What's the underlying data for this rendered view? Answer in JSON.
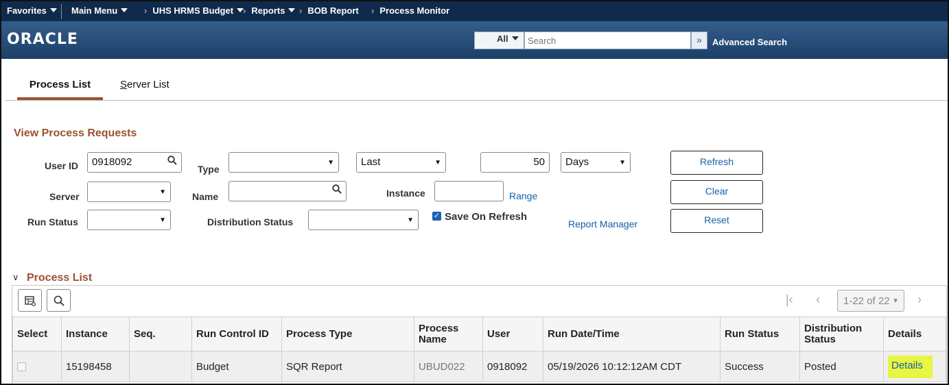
{
  "nav": {
    "favorites": "Favorites",
    "main_menu": "Main Menu",
    "crumbs": [
      "UHS HRMS Budget",
      "Reports",
      "BOB Report",
      "Process Monitor"
    ]
  },
  "banner": {
    "logo": "ORACLE",
    "search_scope": "All",
    "search_placeholder": "Search",
    "advanced_search": "Advanced Search"
  },
  "tabs": {
    "active": "Process List",
    "inactive_first": "S",
    "inactive_rest": "erver List"
  },
  "form": {
    "title": "View Process Requests",
    "user_id_label": "User ID",
    "user_id_value": "0918092",
    "type_label": "Type",
    "type_value": "",
    "period_value": "Last",
    "days_count": "50",
    "days_unit": "Days",
    "server_label": "Server",
    "server_value": "",
    "name_label": "Name",
    "name_value": "",
    "instance_label": "Instance",
    "instance_value": "",
    "range_link": "Range",
    "run_status_label": "Run Status",
    "run_status_value": "",
    "dist_status_label": "Distribution Status",
    "dist_status_value": "",
    "save_on_refresh_label": "Save On Refresh",
    "save_on_refresh_checked": true,
    "report_manager_link": "Report Manager",
    "refresh_button": "Refresh",
    "clear_button": "Clear",
    "reset_button": "Reset"
  },
  "process_list": {
    "title": "Process List",
    "pager": "1-22 of 22",
    "columns": {
      "select": "Select",
      "instance": "Instance",
      "seq": "Seq.",
      "run_control": "Run Control ID",
      "process_type": "Process Type",
      "process_name_1": "Process",
      "process_name_2": "Name",
      "user": "User",
      "run_datetime": "Run Date/Time",
      "run_status": "Run Status",
      "dist_status_1": "Distribution",
      "dist_status_2": "Status",
      "details": "Details"
    },
    "rows": [
      {
        "instance": "15198458",
        "seq": "",
        "run_control": "Budget",
        "process_type": "SQR Report",
        "process_name": "UBUD022",
        "user": "0918092",
        "run_datetime": "05/19/2026 10:12:12AM CDT",
        "run_status": "Success",
        "dist_status": "Posted",
        "details": "Details"
      }
    ]
  },
  "colors": {
    "nav_bg": "#0f2a4a",
    "banner_top": "#355e8c",
    "banner_bottom": "#1c3f67",
    "accent_brown": "#9b5230",
    "link_blue": "#1560a8",
    "highlight_yellow": "#e8f542"
  }
}
